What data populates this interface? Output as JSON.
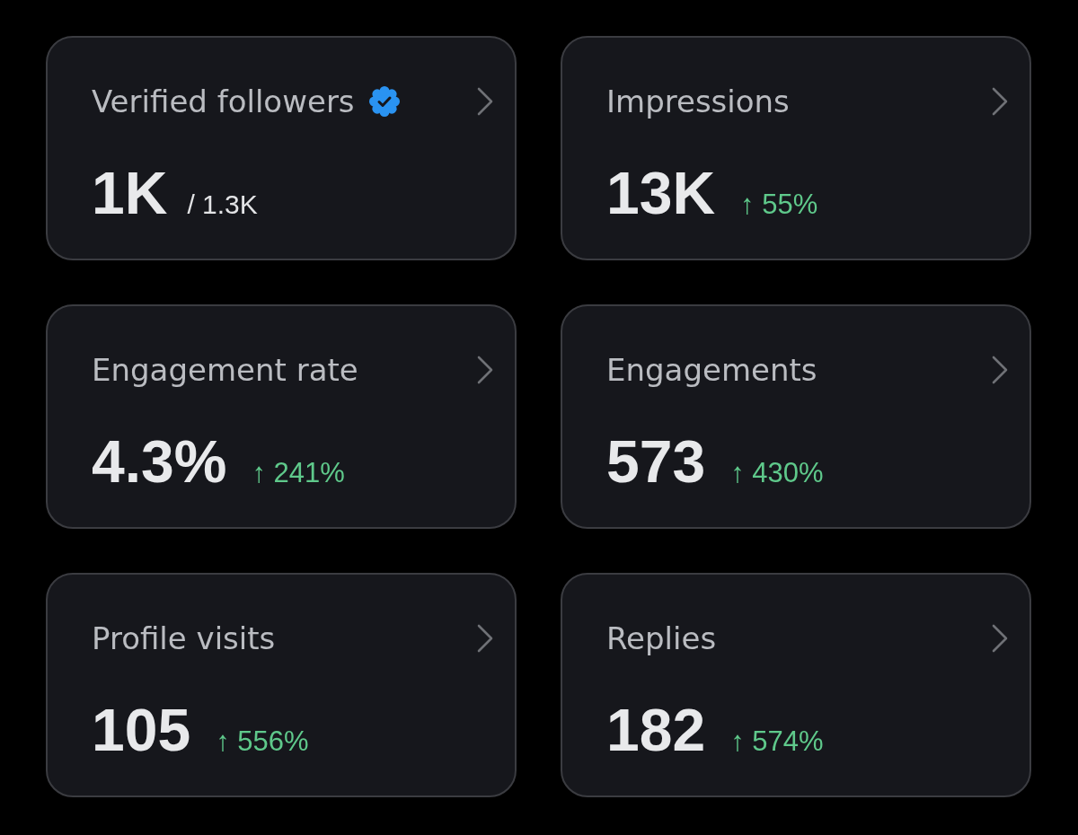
{
  "metrics": [
    {
      "title": "Verified followers",
      "verified": true,
      "value": "1K",
      "total": "/ 1.3K"
    },
    {
      "title": "Impressions",
      "verified": false,
      "value": "13K",
      "change": "↑ 55%"
    },
    {
      "title": "Engagement rate",
      "verified": false,
      "value": "4.3%",
      "change": "↑ 241%"
    },
    {
      "title": "Engagements",
      "verified": false,
      "value": "573",
      "change": "↑ 430%"
    },
    {
      "title": "Profile visits",
      "verified": false,
      "value": "105",
      "change": "↑ 556%"
    },
    {
      "title": "Replies",
      "verified": false,
      "value": "182",
      "change": "↑ 574%"
    }
  ]
}
